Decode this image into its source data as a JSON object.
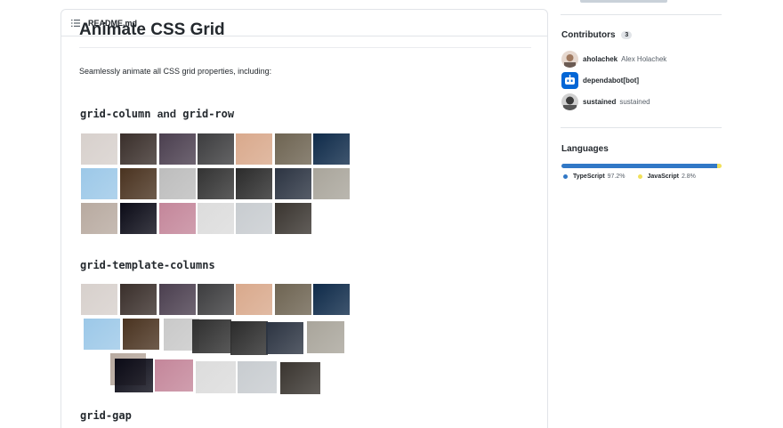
{
  "readme": {
    "filename": "README.md",
    "title": "Animate CSS Grid",
    "intro": "Seamlessly animate all CSS grid properties, including:",
    "sections": [
      {
        "code1": "grid-column",
        "and": "and",
        "code2": "grid-row"
      },
      {
        "code1": "grid-template-columns"
      },
      {
        "code1": "grid-gap"
      }
    ]
  },
  "sidebar": {
    "contributors": {
      "title": "Contributors",
      "count": "3",
      "items": [
        {
          "login": "aholachek",
          "name": "Alex Holachek",
          "avatar_color": "#d9c9be"
        },
        {
          "login": "dependabot[bot]",
          "name": "",
          "avatar_color": "#0366d6"
        },
        {
          "login": "sustained",
          "name": "sustained",
          "avatar_color": "#6a6a6a"
        }
      ]
    },
    "languages": {
      "title": "Languages",
      "items": [
        {
          "name": "TypeScript",
          "percent": "97.2%",
          "value": 97.2,
          "color": "#2b7489"
        },
        {
          "name": "JavaScript",
          "percent": "2.8%",
          "value": 2.8,
          "color": "#f1e05a"
        }
      ]
    }
  },
  "colors": {
    "typescript_bar": "#3178c6",
    "javascript_bar": "#f1e05a"
  },
  "photo_tiles": {
    "grid1": [
      "#d7d0cc",
      "#3a2f2b",
      "#4b3f4f",
      "#3d3d3f",
      "#d9a98c",
      "#6e6452",
      "#0f2b4a",
      "#9cc8e8",
      "#4a3320",
      "#bdbdbd",
      "#333333",
      "#2b2b2b",
      "#2c3442",
      "#a9a59b",
      "#b8aaa0",
      "#0b0b17",
      "#c4869a",
      "#dcdcdc",
      "#c8ccd0",
      "#3a3530"
    ],
    "grid2": [
      "#d7d0cc",
      "#3a2f2b",
      "#4b3f4f",
      "#3d3d3f",
      "#d9a98c",
      "#6e6452",
      "#0f2b4a",
      "#9cc8e8",
      "#4a3320",
      "#c9c9c9",
      "#2f2f2f",
      "#2b2b2b",
      "#2c3442",
      "#a9a59b",
      "#b8aaa0",
      "#0b0b17",
      "#c4869a",
      "#dcdcdc",
      "#c8ccd0",
      "#3a3530"
    ]
  }
}
